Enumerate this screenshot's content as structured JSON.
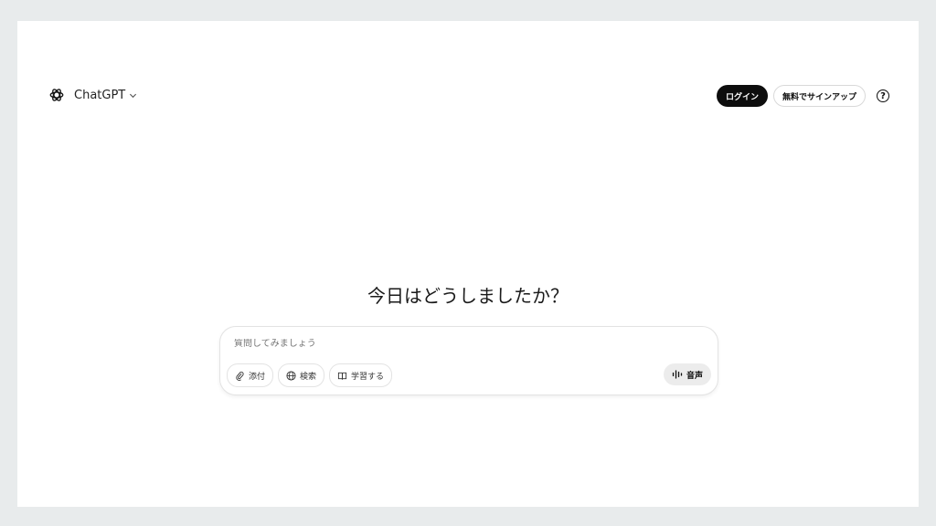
{
  "header": {
    "model_label": "ChatGPT",
    "login_label": "ログイン",
    "signup_label": "無料でサインアップ",
    "help_glyph": "?"
  },
  "main": {
    "greeting": "今日はどうしましたか？"
  },
  "composer": {
    "placeholder": "質問してみましょう",
    "tools": {
      "attach_label": "添付",
      "search_label": "検索",
      "study_label": "学習する"
    },
    "voice_label": "音声"
  },
  "icons": {
    "logo": "openai-logo-icon",
    "chevron": "chevron-down-icon",
    "attach": "paperclip-icon",
    "search": "globe-icon",
    "study": "book-icon",
    "voice": "waveform-icon",
    "help": "help-circle-icon"
  },
  "colors": {
    "background": "#e8ebec",
    "surface": "#ffffff",
    "primary_button": "#0d0d0d",
    "voice_button": "#ececec"
  }
}
